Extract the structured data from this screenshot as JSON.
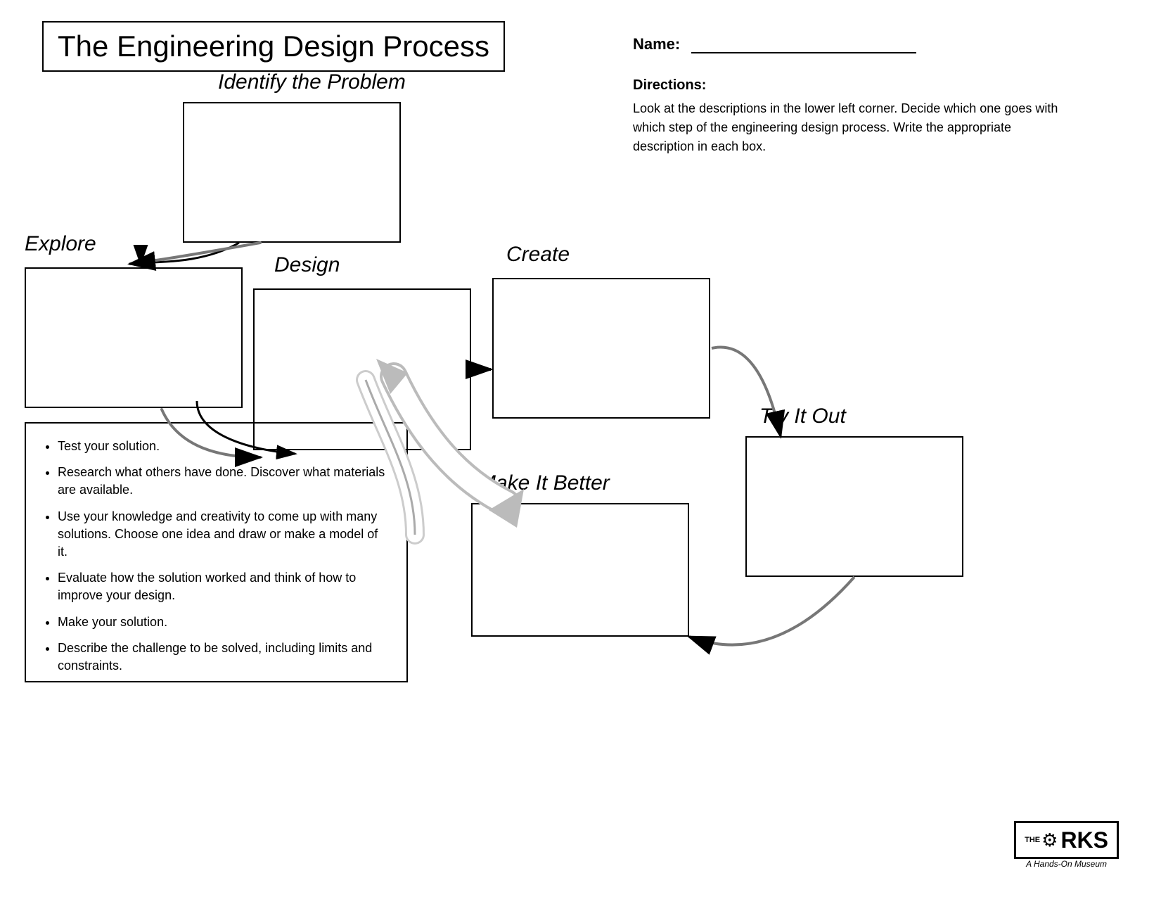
{
  "title": "The Engineering Design Process",
  "name_label": "Name:",
  "directions_title": "Directions:",
  "directions_text": "Look at the descriptions in the lower left corner. Decide which one goes with which step of the engineering design process.  Write the appropriate description in each box.",
  "steps": {
    "identify": "Identify the Problem",
    "explore": "Explore",
    "design": "Design",
    "create": "Create",
    "try_it_out": "Try It Out",
    "make_it_better": "Make It Better"
  },
  "bullets": [
    "Test your solution.",
    "Research what others have done.  Discover what materials are available.",
    "Use your knowledge and creativity to come up with many solutions.  Choose one idea and draw or make a model of it.",
    "Evaluate how the solution worked and think of how to improve your design.",
    "Make your solution.",
    "Describe the challenge to be solved, including limits and constraints."
  ],
  "logo": {
    "the": "THE",
    "works": "W RKS",
    "subtitle": "A Hands-On Museum"
  }
}
